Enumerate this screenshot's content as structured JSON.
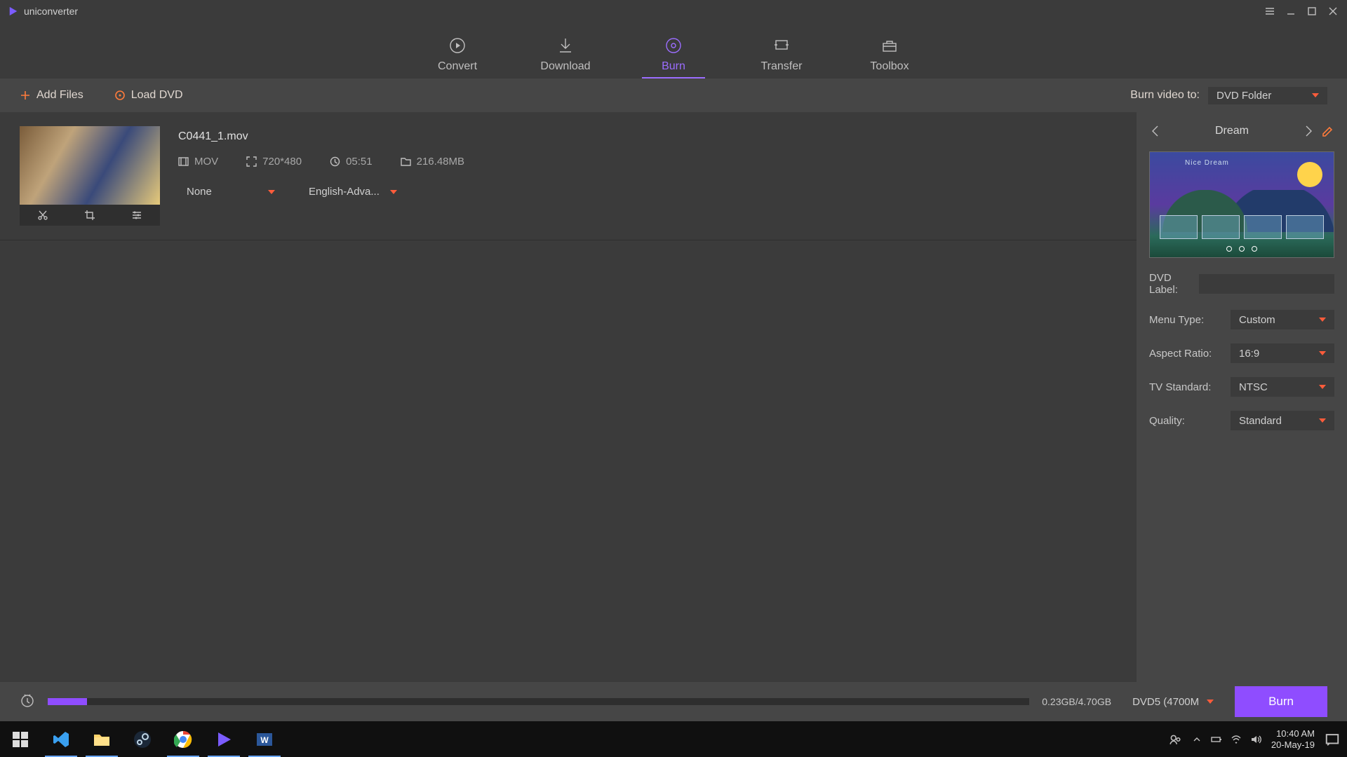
{
  "titlebar": {
    "appname": "uniconverter"
  },
  "tabs": {
    "convert": "Convert",
    "download": "Download",
    "burn": "Burn",
    "transfer": "Transfer",
    "toolbox": "Toolbox"
  },
  "toolbar": {
    "add_files": "Add Files",
    "load_dvd": "Load DVD",
    "burn_to_label": "Burn video to:",
    "burn_to_value": "DVD Folder"
  },
  "file": {
    "name": "C0441_1.mov",
    "format": "MOV",
    "resolution": "720*480",
    "duration": "05:51",
    "size": "216.48MB",
    "subtitle": "None",
    "audio": "English-Adva..."
  },
  "template": {
    "name": "Dream",
    "preview_title": "Nice Dream"
  },
  "settings": {
    "dvd_label_lbl": "DVD Label:",
    "dvd_label_val": "",
    "menu_type_lbl": "Menu Type:",
    "menu_type_val": "Custom",
    "aspect_lbl": "Aspect Ratio:",
    "aspect_val": "16:9",
    "tv_lbl": "TV Standard:",
    "tv_val": "NTSC",
    "quality_lbl": "Quality:",
    "quality_val": "Standard"
  },
  "bottom": {
    "size_text": "0.23GB/4.70GB",
    "disc_type": "DVD5 (4700M",
    "burn_btn": "Burn"
  },
  "taskbar": {
    "time": "10:40 AM",
    "date": "20-May-19"
  }
}
